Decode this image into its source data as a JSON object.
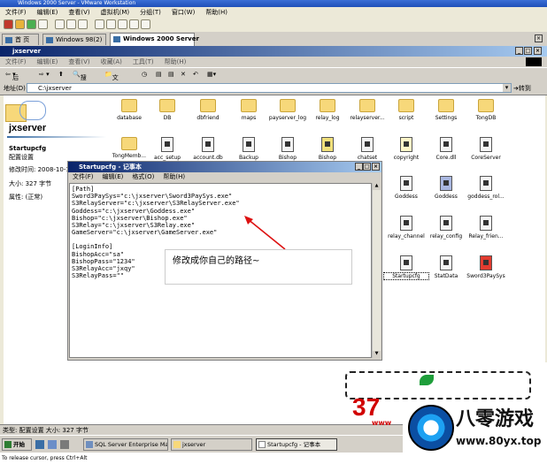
{
  "vm": {
    "title": "Windows 2000 Server - VMware Workstation",
    "menu": [
      "文件(F)",
      "编辑(E)",
      "查看(V)",
      "虚拟机(M)",
      "分组(T)",
      "窗口(W)",
      "帮助(H)"
    ],
    "tabs": [
      "首 页",
      "Windows 98(2)",
      "Windows 2000 Server"
    ],
    "active_tab": "Windows 2000 Server"
  },
  "explorer": {
    "title": "jxserver",
    "menu": [
      "文件(F)",
      "编辑(E)",
      "查看(V)",
      "收藏(A)",
      "工具(T)",
      "帮助(H)"
    ],
    "toolbar": {
      "back": "后退",
      "search": "搜索",
      "folders": "文件夹"
    },
    "address_label": "地址(D)",
    "address": "C:\\jxserver",
    "go": "转到",
    "left_panel": {
      "folder_name": "jxserver",
      "selected_name": "Startupcfg",
      "selected_type": "配置设置",
      "modified": "修改时间: 2008-10-1",
      "size": "大小: 327 字节",
      "attributes": "属性: (正常)"
    },
    "items": [
      {
        "label": "database",
        "kind": "folder"
      },
      {
        "label": "DB",
        "kind": "folder"
      },
      {
        "label": "dbfriend",
        "kind": "folder"
      },
      {
        "label": "maps",
        "kind": "folder"
      },
      {
        "label": "payserver_log",
        "kind": "folder"
      },
      {
        "label": "relay_log",
        "kind": "folder"
      },
      {
        "label": "relayserver...",
        "kind": "folder"
      },
      {
        "label": "script",
        "kind": "folder"
      },
      {
        "label": "Settings",
        "kind": "folder"
      },
      {
        "label": "TongDB",
        "kind": "folder"
      },
      {
        "label": "TongMemb...",
        "kind": "folder"
      },
      {
        "label": "acc_setup",
        "kind": "file"
      },
      {
        "label": "account.db",
        "kind": "file"
      },
      {
        "label": "Backup",
        "kind": "file"
      },
      {
        "label": "Bishop",
        "kind": "file"
      },
      {
        "label": "Bishop",
        "kind": "file"
      },
      {
        "label": "chatset",
        "kind": "file"
      },
      {
        "label": "copyright",
        "kind": "file"
      },
      {
        "label": "Core.dll",
        "kind": "file"
      },
      {
        "label": "CoreServer",
        "kind": "file"
      },
      {
        "label": "Goddess",
        "kind": "file"
      },
      {
        "label": "Goddess",
        "kind": "file"
      },
      {
        "label": "goddess_rol...",
        "kind": "file"
      },
      {
        "label": "relay_channel",
        "kind": "file"
      },
      {
        "label": "relay_config",
        "kind": "file"
      },
      {
        "label": "Relay_frien...",
        "kind": "file"
      },
      {
        "label": "Startupcfg",
        "kind": "file"
      },
      {
        "label": "StatData",
        "kind": "file"
      },
      {
        "label": "Sword3PaySys",
        "kind": "file"
      }
    ]
  },
  "notepad": {
    "title": "Startupcfg - 记事本",
    "menu": [
      "文件(F)",
      "编辑(E)",
      "格式(O)",
      "帮助(H)"
    ],
    "lines": [
      "[Path]",
      "Sword3PaySys=\"c:\\jxserver\\Sword3PaySys.exe\"",
      "S3RelayServer=\"c:\\jxserver\\S3RelayServer.exe\"",
      "Goddess=\"c:\\jxserver\\Goddess.exe\"",
      "Bishop=\"c:\\jxserver\\Bishop.exe\"",
      "S3Relay=\"c:\\jxserver\\S3Relay.exe\"",
      "GameServer=\"c:\\jxserver\\GameServer.exe\"",
      "",
      "[LoginInfo]",
      "BishopAcc=\"sa\"",
      "BishopPass=\"1234\"",
      "S3RelayAcc=\"jxqy\"",
      "S3RelayPass=\"\""
    ]
  },
  "annotation": "修改成你自己的路径~",
  "statusbar": "类型: 配置设置 大小: 327 字节",
  "taskbar": {
    "start": "开始",
    "tasks": [
      "SQL Server Enterprise Ma...",
      "jxserver",
      "Startupcfg - 记事本"
    ],
    "active_task": "Startupcfg - 记事本"
  },
  "bottom_hint": "To release cursor, press Ctrl+Alt",
  "watermark": {
    "number": "37",
    "brand": "八零游戏",
    "url": "www.80yx.top",
    "www": "www"
  }
}
